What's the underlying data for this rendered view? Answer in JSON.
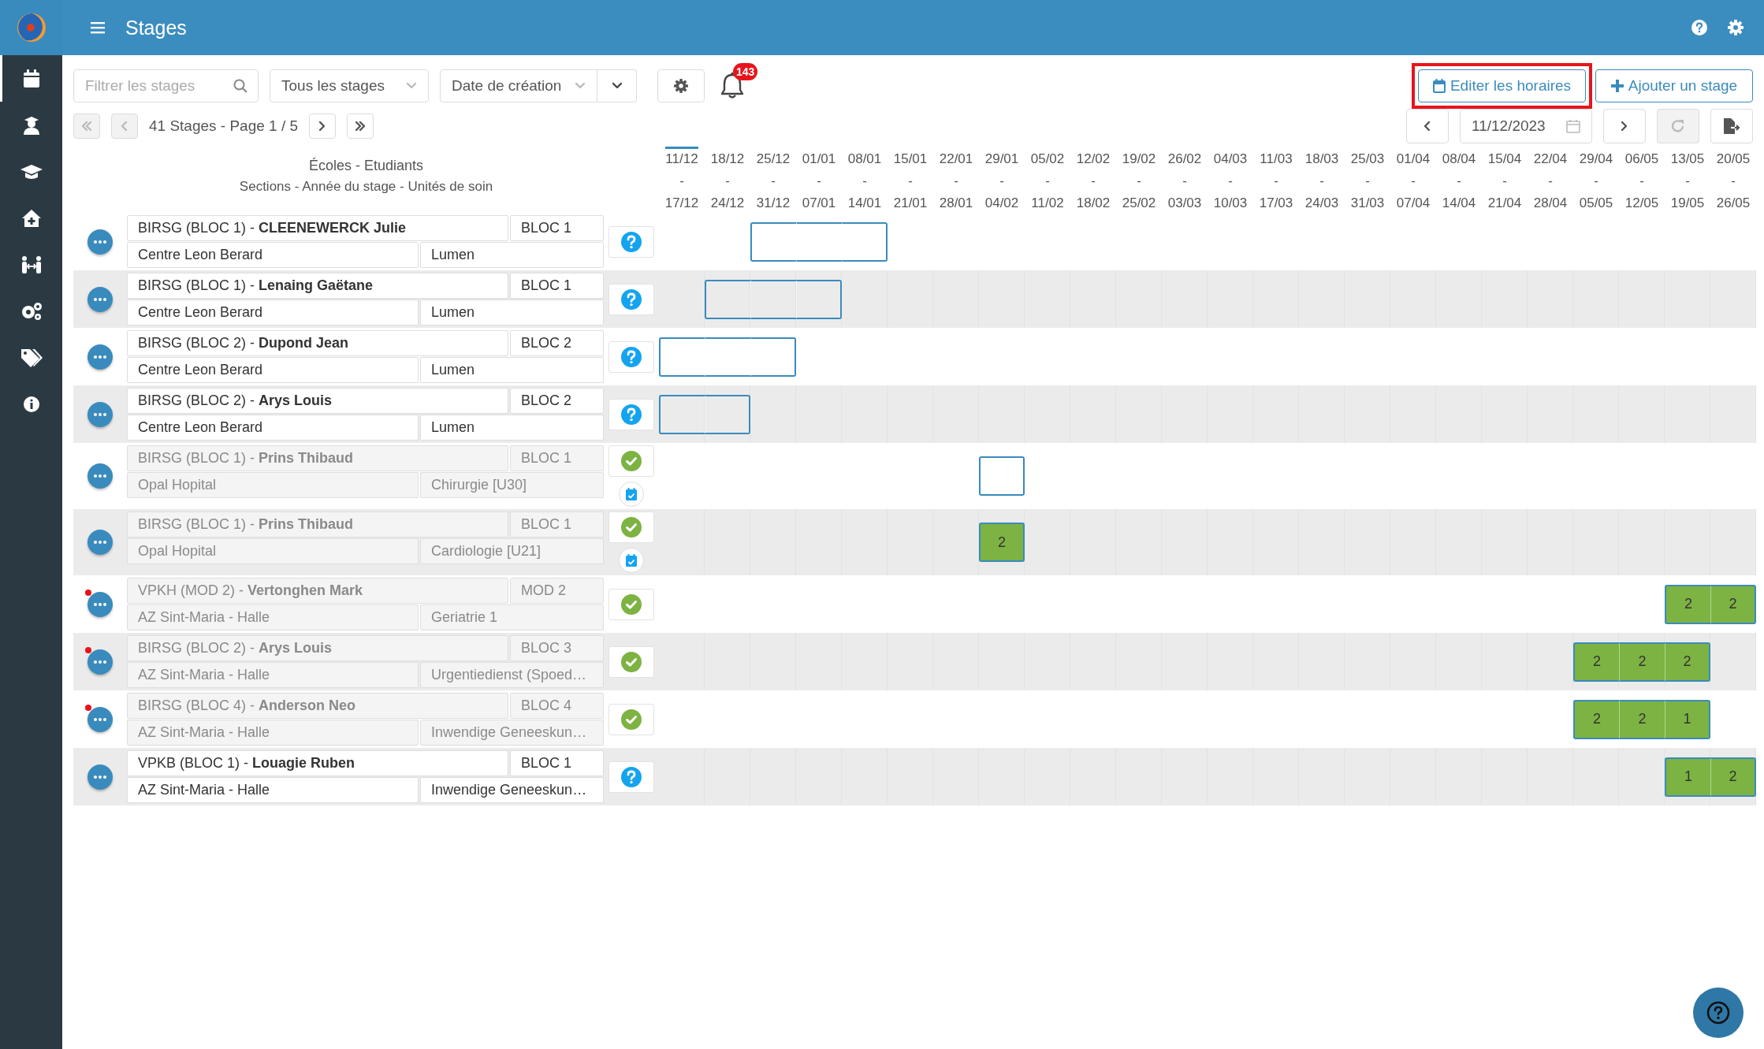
{
  "app": {
    "title": "Stages"
  },
  "sidebar": {
    "items": [
      {
        "kind": "calendar",
        "selected": true
      },
      {
        "kind": "student",
        "selected": false
      },
      {
        "kind": "cap",
        "selected": false
      },
      {
        "kind": "home",
        "selected": false
      },
      {
        "kind": "people",
        "selected": false
      },
      {
        "kind": "gears",
        "selected": false
      },
      {
        "kind": "tags",
        "selected": false
      },
      {
        "kind": "info",
        "selected": false
      }
    ]
  },
  "toolbar": {
    "filter": {
      "placeholder": "Filtrer les stages"
    },
    "stage_filter": {
      "value": "Tous les stages"
    },
    "sort": {
      "value": "Date de création"
    },
    "notifications": {
      "count": "143"
    },
    "edit_schedule": {
      "label": "Editer les horaires",
      "highlighted": true
    },
    "add_stage": {
      "label": "Ajouter un stage"
    }
  },
  "pager": {
    "summary": "41 Stages - Page 1 / 5",
    "buttons": [
      {
        "kind": "first",
        "disabled": true
      },
      {
        "kind": "prev",
        "disabled": true
      },
      {
        "kind": "next",
        "disabled": false
      },
      {
        "kind": "last",
        "disabled": false
      }
    ]
  },
  "date_nav": {
    "date": "11/12/2023",
    "refresh_disabled": true
  },
  "list_header": {
    "title": "Écoles - Etudiants",
    "subtitle": "Sections - Année du stage - Unités de soin"
  },
  "weeks": [
    {
      "start": "11/12",
      "sep": "-",
      "end": "17/12",
      "current": true
    },
    {
      "start": "18/12",
      "sep": "-",
      "end": "24/12",
      "current": false
    },
    {
      "start": "25/12",
      "sep": "-",
      "end": "31/12",
      "current": false
    },
    {
      "start": "01/01",
      "sep": "-",
      "end": "07/01",
      "current": false
    },
    {
      "start": "08/01",
      "sep": "-",
      "end": "14/01",
      "current": false
    },
    {
      "start": "15/01",
      "sep": "-",
      "end": "21/01",
      "current": false
    },
    {
      "start": "22/01",
      "sep": "-",
      "end": "28/01",
      "current": false
    },
    {
      "start": "29/01",
      "sep": "-",
      "end": "04/02",
      "current": false
    },
    {
      "start": "05/02",
      "sep": "-",
      "end": "11/02",
      "current": false
    },
    {
      "start": "12/02",
      "sep": "-",
      "end": "18/02",
      "current": false
    },
    {
      "start": "19/02",
      "sep": "-",
      "end": "25/02",
      "current": false
    },
    {
      "start": "26/02",
      "sep": "-",
      "end": "03/03",
      "current": false
    },
    {
      "start": "04/03",
      "sep": "-",
      "end": "10/03",
      "current": false
    },
    {
      "start": "11/03",
      "sep": "-",
      "end": "17/03",
      "current": false
    },
    {
      "start": "18/03",
      "sep": "-",
      "end": "24/03",
      "current": false
    },
    {
      "start": "25/03",
      "sep": "-",
      "end": "31/03",
      "current": false
    },
    {
      "start": "01/04",
      "sep": "-",
      "end": "07/04",
      "current": false
    },
    {
      "start": "08/04",
      "sep": "-",
      "end": "14/04",
      "current": false
    },
    {
      "start": "15/04",
      "sep": "-",
      "end": "21/04",
      "current": false
    },
    {
      "start": "22/04",
      "sep": "-",
      "end": "28/04",
      "current": false
    },
    {
      "start": "29/04",
      "sep": "-",
      "end": "05/05",
      "current": false
    },
    {
      "start": "06/05",
      "sep": "-",
      "end": "12/05",
      "current": false
    },
    {
      "start": "13/05",
      "sep": "-",
      "end": "19/05",
      "current": false
    },
    {
      "start": "20/05",
      "sep": "-",
      "end": "26/05",
      "current": false
    }
  ],
  "stages": [
    {
      "student": "BIRSG (BLOC 1) - **CLEENEWERCK Julie**",
      "year": "BLOC 1",
      "hospital": "Centre Leon Berard",
      "unit": "Lumen",
      "validated": false,
      "disabled": false,
      "alert": false,
      "schedule_icon": false,
      "slots": [
        {
          "booked": false
        },
        {
          "booked": false
        },
        {
          "booked": true
        },
        {
          "booked": true
        },
        {
          "booked": true
        }
      ]
    },
    {
      "student": "BIRSG (BLOC 1) - **Lenaing Gaëtane**",
      "year": "BLOC 1",
      "hospital": "Centre Leon Berard",
      "unit": "Lumen",
      "validated": false,
      "disabled": false,
      "alert": false,
      "schedule_icon": false,
      "slots": [
        {
          "booked": false
        },
        {
          "booked": true
        },
        {
          "booked": true
        },
        {
          "booked": true
        }
      ]
    },
    {
      "student": "BIRSG (BLOC 2) - **Dupond Jean**",
      "year": "BLOC 2",
      "hospital": "Centre Leon Berard",
      "unit": "Lumen",
      "validated": false,
      "disabled": false,
      "alert": false,
      "schedule_icon": false,
      "slots": [
        {
          "booked": true
        },
        {
          "booked": true
        },
        {
          "booked": true
        }
      ]
    },
    {
      "student": "BIRSG (BLOC 2) - **Arys Louis**",
      "year": "BLOC 2",
      "hospital": "Centre Leon Berard",
      "unit": "Lumen",
      "validated": false,
      "disabled": false,
      "alert": false,
      "schedule_icon": false,
      "slots": [
        {
          "booked": true
        },
        {
          "booked": true
        }
      ]
    },
    {
      "student": "BIRSG (BLOC 1) - **Prins Thibaud**",
      "year": "BLOC 1",
      "hospital": "Opal Hopital",
      "unit": "Chirurgie [U30]",
      "validated": true,
      "disabled": true,
      "alert": false,
      "schedule_icon": true,
      "slots": [
        {
          "booked": false
        },
        {
          "booked": false
        },
        {
          "booked": false
        },
        {
          "booked": false
        },
        {
          "booked": false
        },
        {
          "booked": false
        },
        {
          "booked": false
        },
        {
          "booked": true
        }
      ]
    },
    {
      "student": "BIRSG (BLOC 1) - **Prins Thibaud**",
      "year": "BLOC 1",
      "hospital": "Opal Hopital",
      "unit": "Cardiologie [U21]",
      "validated": true,
      "disabled": true,
      "alert": false,
      "schedule_icon": true,
      "slots": [
        {
          "booked": false
        },
        {
          "booked": false
        },
        {
          "booked": false
        },
        {
          "booked": false
        },
        {
          "booked": false
        },
        {
          "booked": false
        },
        {
          "booked": false
        },
        {
          "booked": true,
          "hours": "2"
        }
      ]
    },
    {
      "student": "VPKH (MOD 2) - **Vertonghen Mark**",
      "year": "MOD 2",
      "hospital": "AZ Sint-Maria - Halle",
      "unit": "Geriatrie 1",
      "validated": true,
      "disabled": true,
      "alert": true,
      "schedule_icon": false,
      "slots": [
        {
          "booked": false
        },
        {
          "booked": false
        },
        {
          "booked": false
        },
        {
          "booked": false
        },
        {
          "booked": false
        },
        {
          "booked": false
        },
        {
          "booked": false
        },
        {
          "booked": false
        },
        {
          "booked": false
        },
        {
          "booked": false
        },
        {
          "booked": false
        },
        {
          "booked": false
        },
        {
          "booked": false
        },
        {
          "booked": false
        },
        {
          "booked": false
        },
        {
          "booked": false
        },
        {
          "booked": false
        },
        {
          "booked": false
        },
        {
          "booked": false
        },
        {
          "booked": false
        },
        {
          "booked": false
        },
        {
          "booked": false
        },
        {
          "booked": true,
          "hours": "2"
        },
        {
          "booked": true,
          "hours": "2"
        }
      ]
    },
    {
      "student": "BIRSG (BLOC 2) - **Arys Louis**",
      "year": "BLOC 3",
      "hospital": "AZ Sint-Maria - Halle",
      "unit": "Urgentiedienst (Spoed…",
      "validated": true,
      "disabled": true,
      "alert": true,
      "schedule_icon": false,
      "slots": [
        {
          "booked": false
        },
        {
          "booked": false
        },
        {
          "booked": false
        },
        {
          "booked": false
        },
        {
          "booked": false
        },
        {
          "booked": false
        },
        {
          "booked": false
        },
        {
          "booked": false
        },
        {
          "booked": false
        },
        {
          "booked": false
        },
        {
          "booked": false
        },
        {
          "booked": false
        },
        {
          "booked": false
        },
        {
          "booked": false
        },
        {
          "booked": false
        },
        {
          "booked": false
        },
        {
          "booked": false
        },
        {
          "booked": false
        },
        {
          "booked": false
        },
        {
          "booked": false
        },
        {
          "booked": true,
          "hours": "2"
        },
        {
          "booked": true,
          "hours": "2"
        },
        {
          "booked": true,
          "hours": "2"
        }
      ]
    },
    {
      "student": "BIRSG (BLOC 4) - **Anderson Neo**",
      "year": "BLOC 4",
      "hospital": "AZ Sint-Maria - Halle",
      "unit": "Inwendige Geneeskun…",
      "validated": true,
      "disabled": true,
      "alert": true,
      "schedule_icon": false,
      "slots": [
        {
          "booked": false
        },
        {
          "booked": false
        },
        {
          "booked": false
        },
        {
          "booked": false
        },
        {
          "booked": false
        },
        {
          "booked": false
        },
        {
          "booked": false
        },
        {
          "booked": false
        },
        {
          "booked": false
        },
        {
          "booked": false
        },
        {
          "booked": false
        },
        {
          "booked": false
        },
        {
          "booked": false
        },
        {
          "booked": false
        },
        {
          "booked": false
        },
        {
          "booked": false
        },
        {
          "booked": false
        },
        {
          "booked": false
        },
        {
          "booked": false
        },
        {
          "booked": false
        },
        {
          "booked": true,
          "hours": "2"
        },
        {
          "booked": true,
          "hours": "2"
        },
        {
          "booked": true,
          "hours": "1"
        }
      ]
    },
    {
      "student": "VPKB (BLOC 1) - **Louagie Ruben**",
      "year": "BLOC 1",
      "hospital": "AZ Sint-Maria - Halle",
      "unit": "Inwendige Geneeskun…",
      "validated": false,
      "disabled": false,
      "alert": false,
      "schedule_icon": false,
      "slots": [
        {
          "booked": false
        },
        {
          "booked": false
        },
        {
          "booked": false
        },
        {
          "booked": false
        },
        {
          "booked": false
        },
        {
          "booked": false
        },
        {
          "booked": false
        },
        {
          "booked": false
        },
        {
          "booked": false
        },
        {
          "booked": false
        },
        {
          "booked": false
        },
        {
          "booked": false
        },
        {
          "booked": false
        },
        {
          "booked": false
        },
        {
          "booked": false
        },
        {
          "booked": false
        },
        {
          "booked": false
        },
        {
          "booked": false
        },
        {
          "booked": false
        },
        {
          "booked": false
        },
        {
          "booked": false
        },
        {
          "booked": false
        },
        {
          "booked": true,
          "hours": "1"
        },
        {
          "booked": true,
          "hours": "2"
        }
      ]
    }
  ]
}
